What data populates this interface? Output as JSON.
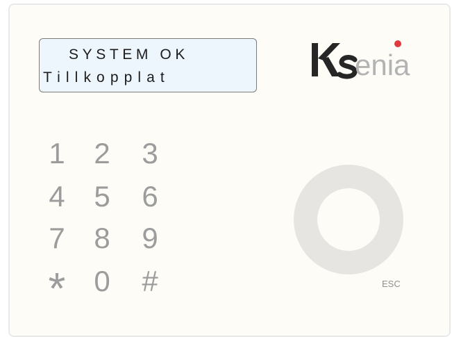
{
  "display": {
    "line1": "SYSTEM OK",
    "line2": "Tillkopplat"
  },
  "brand": {
    "name": "Ksenia",
    "colors": {
      "dark": "#262626",
      "light": "#b3b3b3",
      "dot": "#e03a3e"
    }
  },
  "keypad": {
    "keys": [
      "1",
      "2",
      "3",
      "4",
      "5",
      "6",
      "7",
      "8",
      "9",
      "*",
      "0",
      "#"
    ]
  },
  "esc_button": {
    "label": "ESC"
  }
}
